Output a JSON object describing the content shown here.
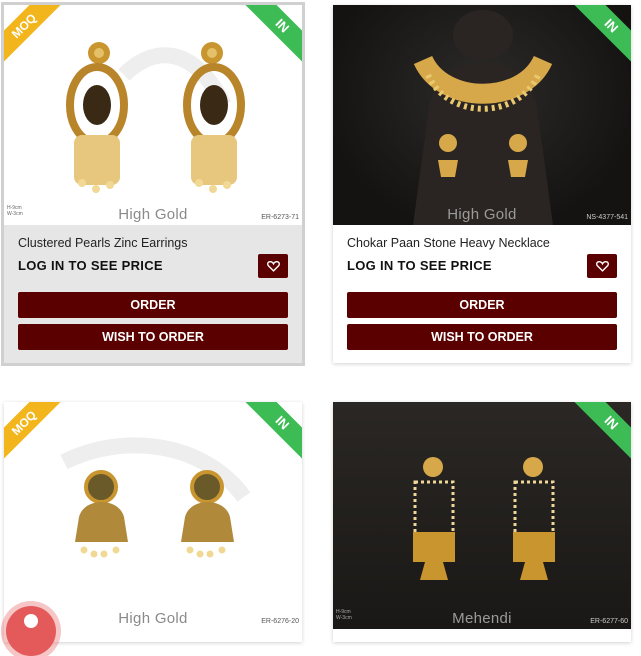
{
  "products": [
    {
      "name": "Clustered Pearls Zinc Earrings",
      "price_text": "LOG IN TO SEE PRICE",
      "order_label": "ORDER",
      "wish_label": "WISH TO ORDER",
      "ribbon_in": "IN",
      "ribbon_moq": "MOQ",
      "watermark": "High Gold",
      "code": "ER-6273-71"
    },
    {
      "name": "Chokar Paan Stone Heavy Necklace",
      "price_text": "LOG IN TO SEE PRICE",
      "order_label": "ORDER",
      "wish_label": "WISH TO ORDER",
      "ribbon_in": "IN",
      "watermark": "High Gold",
      "code": "NS-4377-541"
    },
    {
      "ribbon_in": "IN",
      "ribbon_moq": "MOQ",
      "watermark": "High Gold",
      "code": "ER-6276-20"
    },
    {
      "ribbon_in": "IN",
      "watermark": "Mehendi",
      "code": "ER-6277-60"
    }
  ],
  "colors": {
    "button_bg": "#5b0000",
    "ribbon_in": "#3dbb54",
    "ribbon_moq": "#f2b51c"
  },
  "icons": {
    "favorite": "heart-icon",
    "chat": "chat-icon"
  }
}
